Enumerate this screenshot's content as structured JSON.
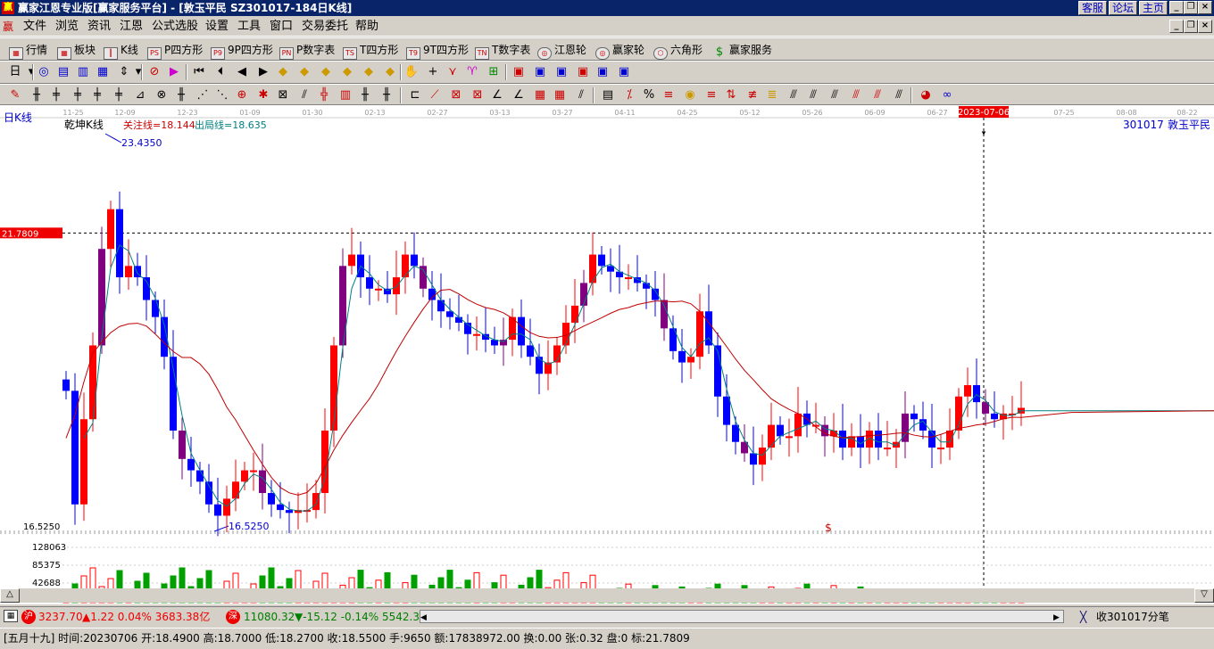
{
  "window": {
    "title": "赢家江恩专业版[赢家服务平台] - [敦玉平民  SZ301017-184日K线]",
    "buttons": [
      "客服",
      "论坛",
      "主页"
    ]
  },
  "menu": {
    "items": [
      "文件",
      "浏览",
      "资讯",
      "江恩",
      "公式选股",
      "设置",
      "工具",
      "窗口",
      "交易委托",
      "帮助"
    ]
  },
  "toolbar1": {
    "items": [
      {
        "label": "行情",
        "icon": "quote-table-icon"
      },
      {
        "label": "板块",
        "icon": "sector-icon"
      },
      {
        "label": "K线",
        "icon": "candlestick-icon"
      },
      {
        "label": "P四方形",
        "icon": "p-square-icon",
        "badge": "PS"
      },
      {
        "label": "9P四方形",
        "icon": "9p-square-icon",
        "badge": "P9"
      },
      {
        "label": "P数字表",
        "icon": "p-number-table-icon",
        "badge": "PN"
      },
      {
        "label": "T四方形",
        "icon": "t-square-icon",
        "badge": "TS"
      },
      {
        "label": "9T四方形",
        "icon": "9t-square-icon",
        "badge": "T9"
      },
      {
        "label": "T数字表",
        "icon": "t-number-table-icon",
        "badge": "TN"
      },
      {
        "label": "江恩轮",
        "icon": "gann-wheel-icon"
      },
      {
        "label": "赢家轮",
        "icon": "winner-wheel-icon"
      },
      {
        "label": "六角形",
        "icon": "hexagon-icon"
      },
      {
        "label": "赢家服务",
        "icon": "dollar-icon"
      }
    ]
  },
  "toolbar2": {
    "period_label": "日"
  },
  "chart": {
    "period_label": "日K线",
    "indicator_name": "乾坤K线",
    "indicator_focus": "关注线=18.144",
    "indicator_exit": "出局线=18.635",
    "high_label": "23.4350",
    "low_label": "16.5250",
    "low_axis_label": "16.5250",
    "cursor_price": "21.7809",
    "cursor_date": "2023-07-06",
    "stock_code": "301017",
    "stock_name": "敦玉平民",
    "dollar_marker": "$",
    "volume_axis": [
      "128063",
      "85375",
      "42688"
    ],
    "date_ticks": [
      "11-25",
      "12-09",
      "12-23",
      "01-09",
      "01-30",
      "02-13",
      "02-27",
      "03-13",
      "03-27",
      "04-11",
      "04-25",
      "05-12",
      "05-26",
      "06-09",
      "06-27",
      "07-25",
      "08-08",
      "08-22"
    ],
    "colors": {
      "up": "#ff0000",
      "down": "#0000ff",
      "purple": "#800080",
      "volume_up": "#ff0000",
      "volume_down": "#00a000",
      "ma_short": "#008080",
      "ma_long": "#c00000"
    }
  },
  "status": {
    "sh_badge": "沪",
    "sh_index": "3237.70",
    "sh_change": "▲1.22 0.04% 3683.38亿",
    "sz_badge": "深",
    "sz_index": "11080.32",
    "sz_change": "▼-15.12 -0.14% 5542.3",
    "receive": "收301017分笔"
  },
  "info": {
    "text": "[五月十九] 时间:20230706 开:18.4900 高:18.7000 低:18.2700 收:18.5500 手:9650 额:17838972.00 换:0.00 张:0.32 盘:0 标:21.7809"
  }
}
